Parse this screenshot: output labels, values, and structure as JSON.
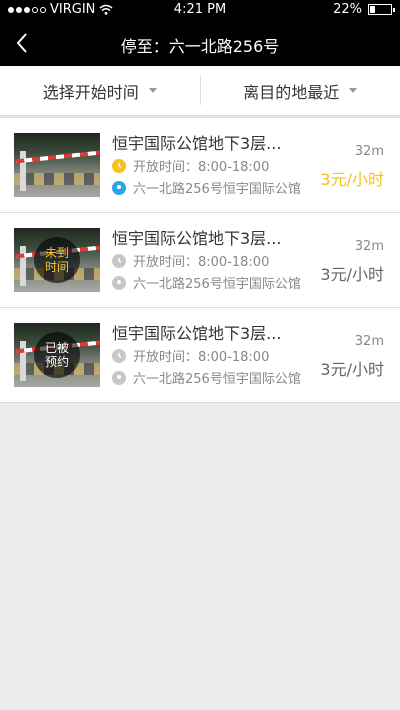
{
  "status": {
    "carrier": "VIRGIN",
    "time": "4:21 PM",
    "battery": "22%"
  },
  "navbar": {
    "title": "停至：六一北路256号"
  },
  "filters": [
    {
      "label": "选择开始时间"
    },
    {
      "label": "离目的地最近"
    }
  ],
  "items": [
    {
      "name": "恒宇国际公馆地下3层...",
      "hours": "开放时间：8:00-18:00",
      "address": "六一北路256号恒宇国际公馆",
      "distance": "32m",
      "price": "3元/小时",
      "badge": "",
      "active": true,
      "colors": {
        "clock": "#f5c219",
        "pin": "#2aa5e8",
        "price": "#f5c219"
      }
    },
    {
      "name": "恒宇国际公馆地下3层...",
      "hours": "开放时间：8:00-18:00",
      "address": "六一北路256号恒宇国际公馆",
      "distance": "32m",
      "price": "3元/小时",
      "badge_line1": "未到",
      "badge_line2": "时间",
      "active": false,
      "colors": {
        "badge_text": "#f7c92b"
      }
    },
    {
      "name": "恒宇国际公馆地下3层...",
      "hours": "开放时间：8:00-18:00",
      "address": "六一北路256号恒宇国际公馆",
      "distance": "32m",
      "price": "3元/小时",
      "badge_line1": "已被",
      "badge_line2": "预约",
      "active": false,
      "colors": {
        "badge_text": "#ffffff"
      }
    }
  ],
  "icons": {
    "back": "chevron-left-icon",
    "wifi": "wifi-icon",
    "clock": "clock-icon",
    "pin": "location-pin-icon",
    "battery": "battery-icon"
  }
}
